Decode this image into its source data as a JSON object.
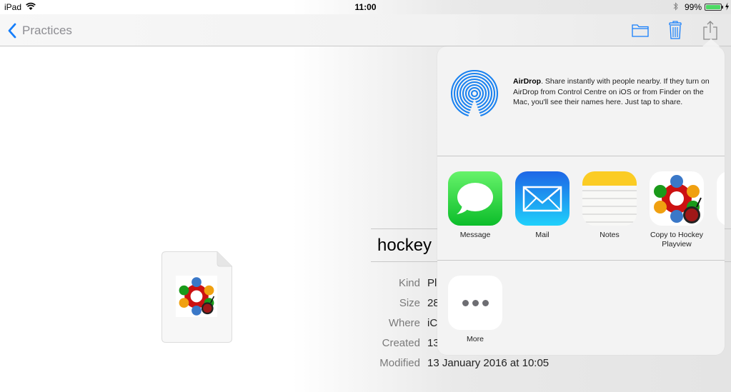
{
  "status_bar": {
    "device": "iPad",
    "time": "11:00",
    "battery_percent": "99%",
    "battery_level": 0.99,
    "icons": [
      "wifi-icon",
      "bluetooth-icon",
      "battery-icon",
      "charging-bolt-icon"
    ]
  },
  "nav_bar": {
    "back_label": "Practices",
    "actions": [
      "folder-icon",
      "trash-icon",
      "share-icon"
    ],
    "accent_color": "#157efb"
  },
  "document": {
    "title_visible": "hockey",
    "info": [
      {
        "key": "Kind",
        "value": "Pl"
      },
      {
        "key": "Size",
        "value": "28"
      },
      {
        "key": "Where",
        "value": "iC"
      },
      {
        "key": "Created",
        "value": "13"
      },
      {
        "key": "Modified",
        "value": "13 January 2016 at 10:05"
      }
    ]
  },
  "share_sheet": {
    "airdrop": {
      "title": "AirDrop",
      "description": ". Share instantly with people nearby. If they turn on AirDrop from Control Centre on iOS or from Finder on the Mac, you'll see their names here. Just tap to share."
    },
    "apps": [
      {
        "label": "Message",
        "icon": "messages-icon"
      },
      {
        "label": "Mail",
        "icon": "mail-icon"
      },
      {
        "label": "Notes",
        "icon": "notes-icon"
      },
      {
        "label": "Copy to Hockey Playview",
        "icon": "hockey-playview-icon"
      }
    ],
    "actions": [
      {
        "label": "More",
        "icon": "more-icon"
      }
    ]
  }
}
